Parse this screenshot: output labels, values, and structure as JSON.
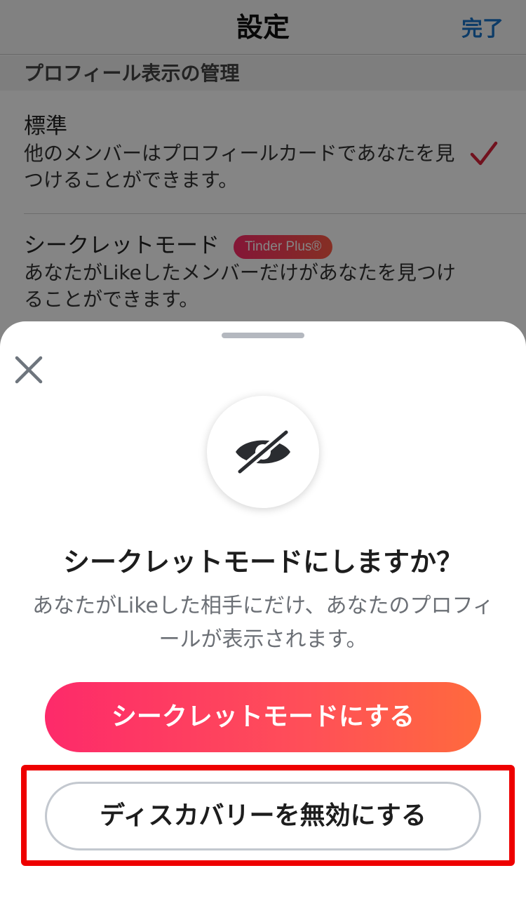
{
  "nav": {
    "title": "設定",
    "done_label": "完了"
  },
  "section": {
    "header": "プロフィール表示の管理"
  },
  "options": [
    {
      "title": "標準",
      "description": "他のメンバーはプロフィールカードであなたを見つけることができます。",
      "selected": true
    },
    {
      "title": "シークレットモード",
      "badge": "Tinder Plus®",
      "description": "あなたがLikeしたメンバーだけがあなたを見つけることができます。",
      "selected": false
    }
  ],
  "sheet": {
    "icon": "eye-slash-icon",
    "title": "シークレットモードにしますか？",
    "description": "あなたがLikeした相手にだけ、あなたのプロフィールが表示されます。",
    "primary_label": "シークレットモードにする",
    "secondary_label": "ディスカバリーを無効にする"
  },
  "colors": {
    "brand_gradient_start": "#fd2a6a",
    "brand_gradient_end": "#ff6a3d",
    "check": "#d8243a",
    "highlight": "#ee0000",
    "done_link": "#1a73c8"
  }
}
